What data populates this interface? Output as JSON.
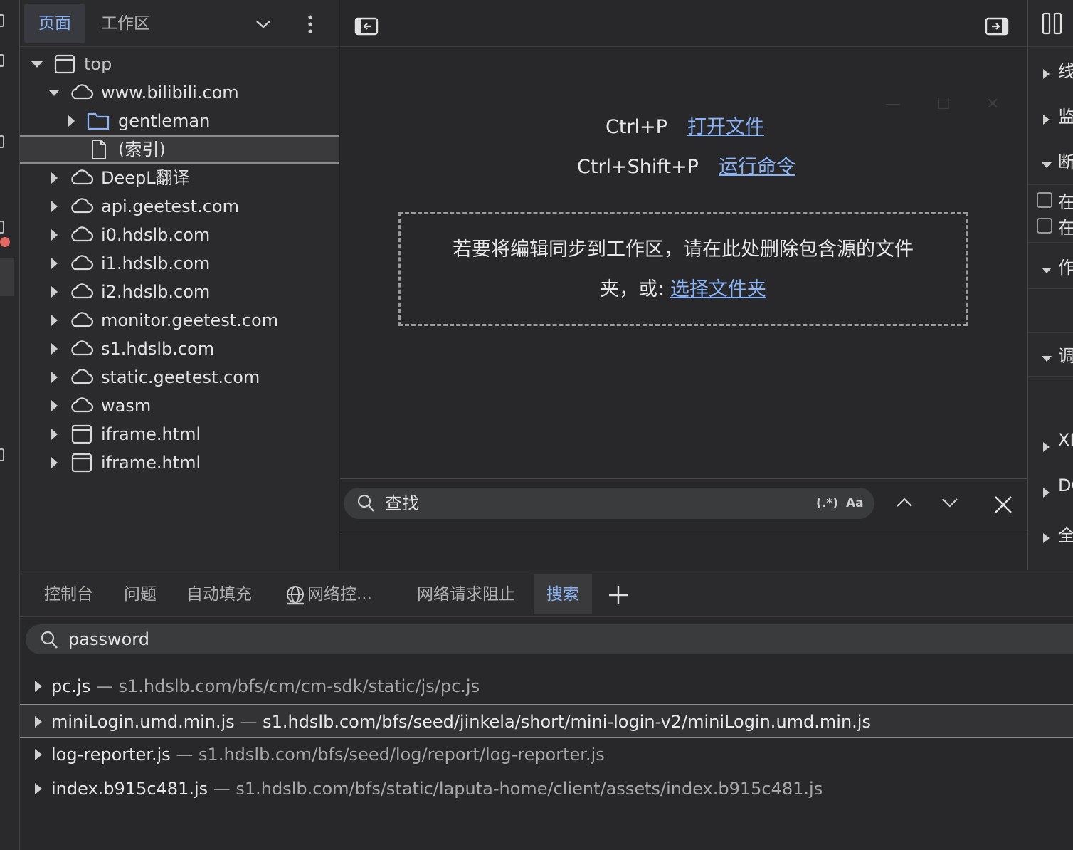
{
  "navigator": {
    "tabs": [
      "页面",
      "工作区"
    ],
    "tree": [
      {
        "label": "top",
        "icon": "frame-icon",
        "expanded": true
      },
      {
        "label": "www.bilibili.com",
        "icon": "cloud-icon",
        "expanded": true
      },
      {
        "label": "gentleman",
        "icon": "folder-icon",
        "expanded": false
      },
      {
        "label": "(索引)",
        "icon": "file-icon",
        "selected": true
      },
      {
        "label": "DeepL翻译",
        "icon": "cloud-icon",
        "expanded": false
      },
      {
        "label": "api.geetest.com",
        "icon": "cloud-icon",
        "expanded": false
      },
      {
        "label": "i0.hdslb.com",
        "icon": "cloud-icon",
        "expanded": false
      },
      {
        "label": "i1.hdslb.com",
        "icon": "cloud-icon",
        "expanded": false
      },
      {
        "label": "i2.hdslb.com",
        "icon": "cloud-icon",
        "expanded": false
      },
      {
        "label": "monitor.geetest.com",
        "icon": "cloud-icon",
        "expanded": false
      },
      {
        "label": "s1.hdslb.com",
        "icon": "cloud-icon",
        "expanded": false
      },
      {
        "label": "static.geetest.com",
        "icon": "cloud-icon",
        "expanded": false
      },
      {
        "label": "wasm",
        "icon": "cloud-icon",
        "expanded": false
      },
      {
        "label": "iframe.html",
        "icon": "frame-icon",
        "expanded": false
      },
      {
        "label": "iframe.html",
        "icon": "frame-icon",
        "expanded": false
      }
    ]
  },
  "editor": {
    "shortcut_open_key": "Ctrl+P",
    "shortcut_open_label": "打开文件",
    "shortcut_run_key": "Ctrl+Shift+P",
    "shortcut_run_label": "运行命令",
    "drop_text_line1": "若要将编辑同步到工作区，请在此处删除包含源的文件",
    "drop_text_line2": "夹，或: ",
    "drop_link": "选择文件夹",
    "find_placeholder": "查找",
    "find_regex": "(.*)",
    "find_case": "Aa"
  },
  "right_sidebar": {
    "sections": [
      "线",
      "监",
      "断",
      "在",
      "在",
      "作",
      "调",
      "XH",
      "DO",
      "全"
    ]
  },
  "drawer": {
    "tabs": [
      "控制台",
      "问题",
      "自动填充",
      "网络控...",
      "网络请求阻止",
      "搜索"
    ],
    "active_tab": "搜索",
    "search_value": "password",
    "results": [
      {
        "file": "pc.js",
        "sep": " — ",
        "path": "s1.hdslb.com/bfs/cm/cm-sdk/static/js/pc.js"
      },
      {
        "file": "miniLogin.umd.min.js",
        "sep": " — ",
        "path": "s1.hdslb.com/bfs/seed/jinkela/short/mini-login-v2/miniLogin.umd.min.js",
        "selected": true
      },
      {
        "file": "log-reporter.js",
        "sep": " — ",
        "path": "s1.hdslb.com/bfs/seed/log/report/log-reporter.js"
      },
      {
        "file": "index.b915c481.js",
        "sep": " — ",
        "path": "s1.hdslb.com/bfs/static/laputa-home/client/assets/index.b915c481.js"
      }
    ]
  },
  "colors": {
    "accent": "#8ab4f8",
    "background": "#202124",
    "panel": "#2b2b2d"
  }
}
